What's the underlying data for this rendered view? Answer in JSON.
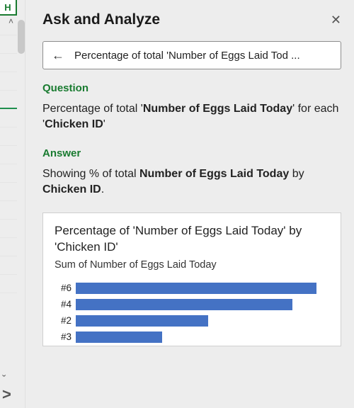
{
  "left": {
    "colhead": "H",
    "caret": "˄"
  },
  "panel": {
    "title": "Ask and Analyze",
    "close_glyph": "✕",
    "back_glyph": "←",
    "query_text": "Percentage of total 'Number of Eggs Laid Tod  ...",
    "question_label": "Question",
    "question_prefix": "Percentage of total '",
    "question_bold1": "Number of Eggs Laid Today",
    "question_mid": "' for each '",
    "question_bold2": "Chicken ID",
    "question_suffix": "'",
    "answer_label": "Answer",
    "answer_prefix": "Showing % of total ",
    "answer_bold1": "Number of Eggs Laid Today",
    "answer_mid": " by ",
    "answer_bold2": "Chicken ID",
    "answer_suffix": "."
  },
  "chart": {
    "title": "Percentage of 'Number of Eggs Laid Today' by 'Chicken ID'",
    "subtitle": "Sum of Number of Eggs Laid Today"
  },
  "chart_data": {
    "type": "bar",
    "orientation": "horizontal",
    "categories": [
      "#6",
      "#4",
      "#2",
      "#3"
    ],
    "values": [
      100,
      90,
      55,
      36
    ],
    "title": "Percentage of 'Number of Eggs Laid Today' by 'Chicken ID'",
    "xlabel": "Sum of Number of Eggs Laid Today",
    "ylabel": "Chicken ID",
    "xlim": [
      0,
      100
    ],
    "bar_color": "#4472c4"
  },
  "icons": {
    "sheet_caret": "ˇ",
    "sheet_chevron": ">"
  }
}
